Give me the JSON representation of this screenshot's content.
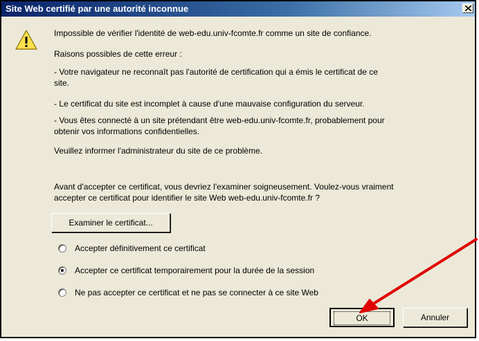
{
  "dialog": {
    "title": "Site Web certifié par une autorité inconnue",
    "close_symbol": "×"
  },
  "content": {
    "intro": "Impossible de vérifier l'identité de web-edu.univ-fcomte.fr comme un site de confiance.",
    "reasons_heading": "Raisons possibles de cette erreur :",
    "reason1_line1": "- Votre navigateur ne reconnaît pas l'autorité de certification qui a émis le certificat de ce",
    "reason1_line2": "site.",
    "reason2": "- Le certificat du site est incomplet à cause d'une mauvaise configuration du serveur.",
    "reason3_line1": "- Vous êtes connecté à un site prétendant être web-edu.univ-fcomte.fr, probablement pour",
    "reason3_line2": "obtenir vos informations confidentielles.",
    "inform": "Veuillez informer l'administrateur du site de ce problème.",
    "before_line1": "Avant d'accepter ce certificat, vous devriez l'examiner soigneusement. Voulez-vous vraiment",
    "before_line2": "accepter ce certificat pour identifier le site Web web-edu.univ-fcomte.fr ?"
  },
  "buttons": {
    "examine": "Examiner le certificat...",
    "ok": "OK",
    "cancel": "Annuler"
  },
  "options": [
    {
      "label": "Accepter définitivement ce certificat",
      "selected": false
    },
    {
      "label": "Accepter ce certificat temporairement pour la durée de la session",
      "selected": true
    },
    {
      "label": "Ne pas accepter ce certificat et ne pas se connecter à ce site Web",
      "selected": false
    }
  ],
  "icons": {
    "warning": "warning-icon",
    "close": "close-icon",
    "annotation": "red-arrow"
  },
  "colors": {
    "title_start": "#0a246a",
    "title_end": "#a6caf0",
    "face": "#ece9d8",
    "arrow": "#e00000",
    "warning_fill": "#ffe14d"
  }
}
